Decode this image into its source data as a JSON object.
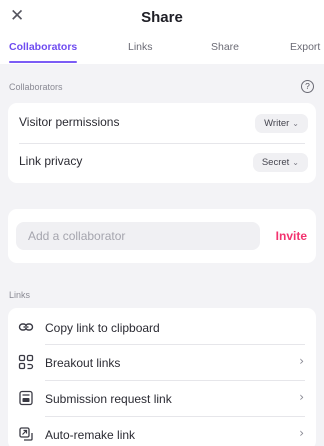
{
  "header": {
    "close_icon": "close-icon",
    "title": "Share"
  },
  "tabs": [
    {
      "label": "Collaborators",
      "active": true
    },
    {
      "label": "Links",
      "active": false
    },
    {
      "label": "Share",
      "active": false
    },
    {
      "label": "Export",
      "active": false
    }
  ],
  "collaborators": {
    "section_label": "Collaborators",
    "help_glyph": "?",
    "rows": [
      {
        "label": "Visitor permissions",
        "value": "Writer"
      },
      {
        "label": "Link privacy",
        "value": "Secret"
      }
    ]
  },
  "invite": {
    "placeholder": "Add a collaborator",
    "button_label": "Invite"
  },
  "links": {
    "section_label": "Links",
    "items": [
      {
        "label": "Copy link to clipboard",
        "icon": "link-icon"
      },
      {
        "label": "Breakout links",
        "icon": "breakout-icon"
      },
      {
        "label": "Submission request link",
        "icon": "submission-icon"
      },
      {
        "label": "Auto-remake link",
        "icon": "auto-remake-icon"
      }
    ]
  },
  "colors": {
    "accent": "#7b5cf5",
    "invite": "#f2336f",
    "background": "#f3f3f6"
  }
}
